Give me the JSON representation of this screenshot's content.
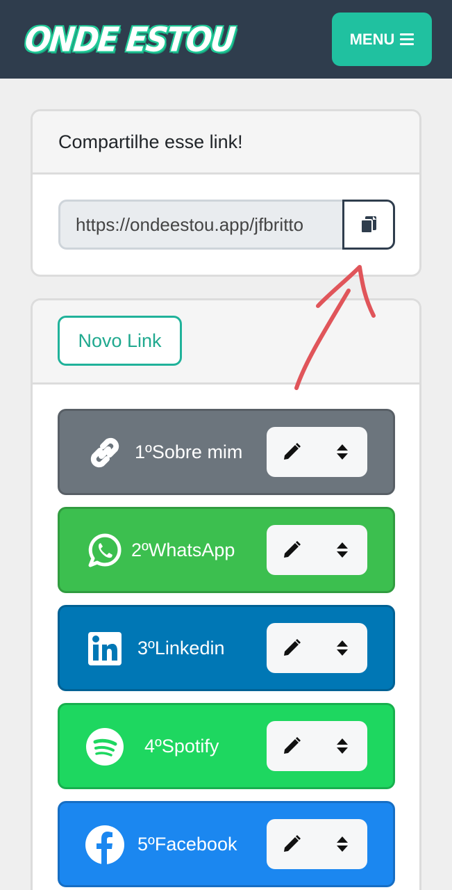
{
  "header": {
    "brand_text": "ONDE ESTOU",
    "menu_label": "MENU",
    "menu_icon": "hamburger-icon"
  },
  "share_card": {
    "title": "Compartilhe esse link!",
    "link_value": "https://ondeestou.app/jfbritto",
    "copy_icon": "copy-icon"
  },
  "links_card": {
    "new_link_label": "Novo Link",
    "items": [
      {
        "position": "1º",
        "name": "Sobre mim",
        "icon": "link-icon",
        "color": "#6c757d"
      },
      {
        "position": "2º",
        "name": "WhatsApp",
        "icon": "whatsapp-icon",
        "color": "#3cbf4f"
      },
      {
        "position": "3º",
        "name": "Linkedin",
        "icon": "linkedin-icon",
        "color": "#0077b5"
      },
      {
        "position": "4º",
        "name": "Spotify",
        "icon": "spotify-icon",
        "color": "#1ed760"
      },
      {
        "position": "5º",
        "name": "Facebook",
        "icon": "facebook-icon",
        "color": "#1b87f0"
      }
    ],
    "edit_icon": "pencil-icon",
    "reorder_icon": "sort-icon"
  },
  "colors": {
    "navbar": "#2f3d4d",
    "accent": "#20c1a0",
    "annotation_arrow": "#e0555a"
  }
}
